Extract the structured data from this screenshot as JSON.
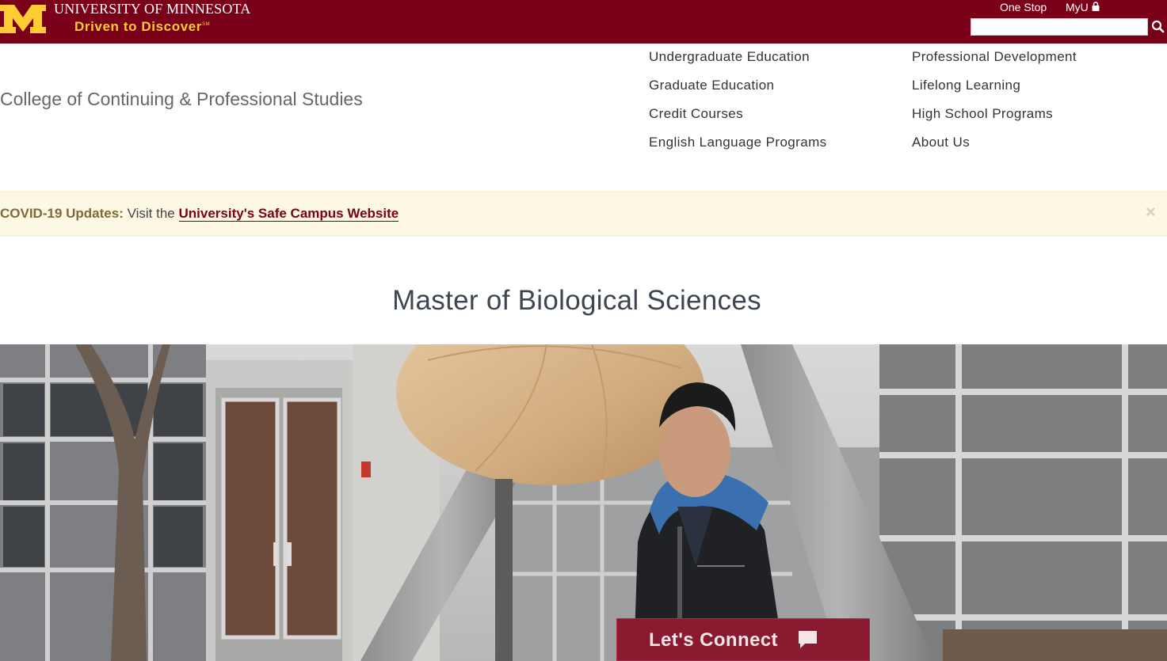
{
  "header": {
    "university_name": "University of Minnesota",
    "university_name_display": "UNIVERSITY OF MINNESOTA",
    "tagline": "Driven to Discover",
    "tagline_mark": "SM",
    "logo_icon": "block-m-logo",
    "quick_links": [
      {
        "label": "One Stop"
      },
      {
        "label": "MyU",
        "icon": "lock-icon"
      }
    ],
    "search": {
      "placeholder": "",
      "value": "",
      "icon": "search-icon"
    },
    "colors": {
      "maroon": "#7a0019",
      "gold": "#ffcc33"
    }
  },
  "college": {
    "title": "College of Continuing & Professional Studies"
  },
  "nav": {
    "left": [
      {
        "label": "Undergraduate Education"
      },
      {
        "label": "Graduate Education"
      },
      {
        "label": "Credit Courses"
      },
      {
        "label": "English Language Programs"
      }
    ],
    "right": [
      {
        "label": "Professional Development"
      },
      {
        "label": "Lifelong Learning"
      },
      {
        "label": "High School Programs"
      },
      {
        "label": "About Us"
      }
    ]
  },
  "alert": {
    "prefix": "COVID-19 Updates:",
    "text": " Visit the ",
    "link": "University's Safe Campus Website",
    "close": "×",
    "background": "#fcf8e3"
  },
  "page": {
    "title": "Master of Biological Sciences"
  },
  "hero": {
    "description_icon": "hero-photo"
  },
  "connect": {
    "label": "Let's Connect",
    "icon": "chat-bubble-icon"
  }
}
